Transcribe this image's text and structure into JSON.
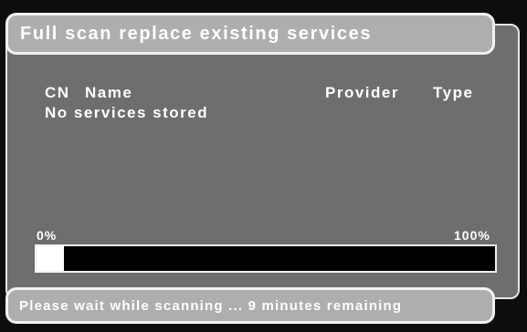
{
  "title": "Full scan replace existing services",
  "columns": {
    "cn": "CN",
    "name": "Name",
    "provider": "Provider",
    "type": "Type"
  },
  "empty_message": "No services stored",
  "progress": {
    "min_label": "0%",
    "max_label": "100%",
    "value_fraction": 0.06
  },
  "status": "Please wait while scanning ... 9 minutes remaining",
  "colors": {
    "panel": "#6e6e6e",
    "bar": "#aeaeae",
    "border": "#f2f2f2",
    "text": "#ffffff",
    "background": "#0d0d0d"
  }
}
